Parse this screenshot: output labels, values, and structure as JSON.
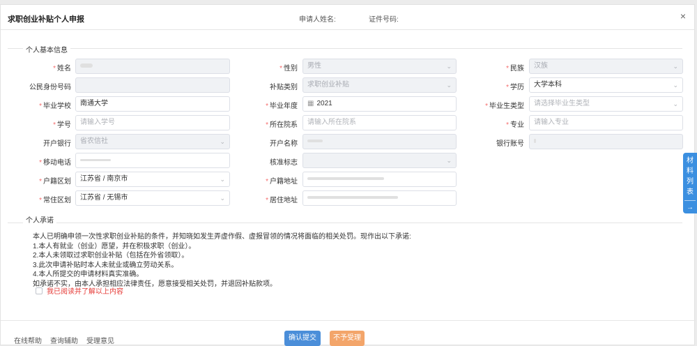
{
  "header": {
    "title": "求职创业补贴个人申报",
    "applicant_label": "申请人姓名:",
    "id_label": "证件号码:",
    "close_symbol": "×"
  },
  "basic_info": {
    "section_title": "个人基本信息",
    "fields": {
      "name": {
        "label": "姓名",
        "value": ""
      },
      "gender": {
        "label": "性别",
        "value": "男性"
      },
      "ethnicity": {
        "label": "民族",
        "value": "汉族"
      },
      "id_number": {
        "label": "公民身份号码",
        "value": ""
      },
      "subsidy_type": {
        "label": "补贴类别",
        "value": "求职创业补贴"
      },
      "education": {
        "label": "学历",
        "value": "大学本科"
      },
      "school": {
        "label": "毕业学校",
        "value": "南通大学"
      },
      "grad_year": {
        "label": "毕业年度",
        "value": "2021"
      },
      "grad_type": {
        "label": "毕业生类型",
        "placeholder": "请选择毕业生类型"
      },
      "student_no": {
        "label": "学号",
        "placeholder": "请输入学号"
      },
      "department": {
        "label": "所在院系",
        "placeholder": "请输入所在院系"
      },
      "major": {
        "label": "专业",
        "placeholder": "请输入专业"
      },
      "bank": {
        "label": "开户银行",
        "value": "省农信社"
      },
      "account_name": {
        "label": "开户名称",
        "value": ""
      },
      "bank_account": {
        "label": "银行账号",
        "value": ""
      },
      "mobile": {
        "label": "移动电话",
        "value": ""
      },
      "verify_flag": {
        "label": "核准标志",
        "value": ""
      },
      "hukou_region": {
        "label": "户籍区划",
        "value": "江苏省 / 南京市"
      },
      "hukou_address": {
        "label": "户籍地址",
        "value": ""
      },
      "residence_region": {
        "label": "常住区划",
        "value": "江苏省 / 无锡市"
      },
      "residence_address": {
        "label": "居住地址",
        "value": ""
      }
    }
  },
  "commitment": {
    "section_title": "个人承诺",
    "lines": [
      "本人已明确申领一次性求职创业补贴的条件，并知晓如发生弄虚作假、虚报冒领的情况将面临的相关处罚。现作出以下承诺:",
      "1.本人有就业（创业）愿望，并在积极求职（创业）。",
      "2.本人未领取过求职创业补贴（包括在外省领取）。",
      "3.此次申请补贴时本人未就业或确立劳动关系。",
      "4.本人所提交的申请材料真实准确。",
      "如承诺不实，由本人承担相应法律责任，愿意接受相关处罚，并退回补贴款项。"
    ],
    "checkbox_label": "我已阅读并了解以上内容"
  },
  "footer": {
    "links": [
      "在线帮助",
      "查询辅助",
      "受理意见"
    ],
    "submit_label": "确认提交",
    "reject_label": "不予受理"
  },
  "side_tab": {
    "chars": [
      "材",
      "料",
      "列",
      "表"
    ],
    "arrow": "→"
  },
  "colors": {
    "primary": "#4b8ed9",
    "warning": "#f3a56a",
    "required": "#f56c6c",
    "side_tab": "#3b8fe0"
  }
}
